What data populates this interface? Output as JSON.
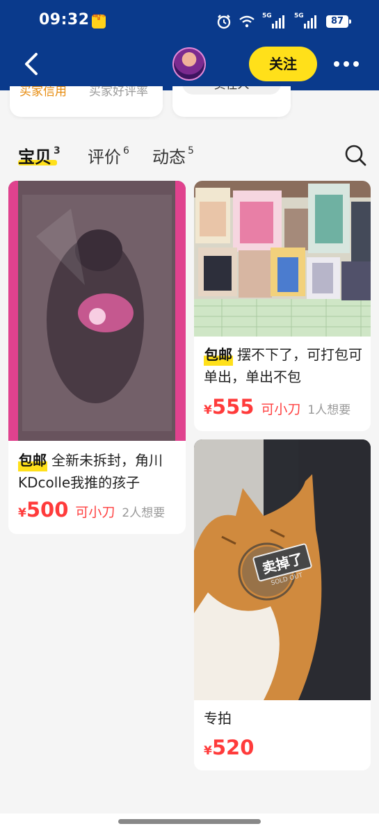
{
  "status_bar": {
    "time": "09:32",
    "app_badge": "买回 千·小店",
    "network_1": "5G",
    "network_2": "5G",
    "battery": "87"
  },
  "header": {
    "follow_label": "关注",
    "colors": {
      "background": "#0a3a8c",
      "follow_button": "#ffe01a"
    }
  },
  "profile_cards": {
    "credit_label": "买家信用",
    "credit_value": "买家好评率",
    "seller_button": "卖在人"
  },
  "tabs": [
    {
      "label": "宝贝",
      "count": "3",
      "active": true
    },
    {
      "label": "评价",
      "count": "6",
      "active": false
    },
    {
      "label": "动态",
      "count": "5",
      "active": false
    }
  ],
  "listings": [
    {
      "badge": "包邮",
      "title": "全新未拆封，角川KDcolle我推的孩子",
      "currency": "¥",
      "price": "500",
      "bargain": "可小刀",
      "wants": "2人想要",
      "sold": false
    },
    {
      "badge": "包邮",
      "title": "摆不下了，可打包可单出，单出不包",
      "currency": "¥",
      "price": "555",
      "bargain": "可小刀",
      "wants": "1人想要",
      "sold": false
    },
    {
      "badge": "",
      "title": "专拍",
      "currency": "¥",
      "price": "520",
      "bargain": "",
      "wants": "",
      "sold": true,
      "sold_stamp": "卖掉了",
      "sold_stamp_sub": "SOLD OUT"
    }
  ],
  "colors": {
    "price": "#ff3b3b",
    "highlight": "#ffe01a",
    "credit": "#e6890a"
  }
}
